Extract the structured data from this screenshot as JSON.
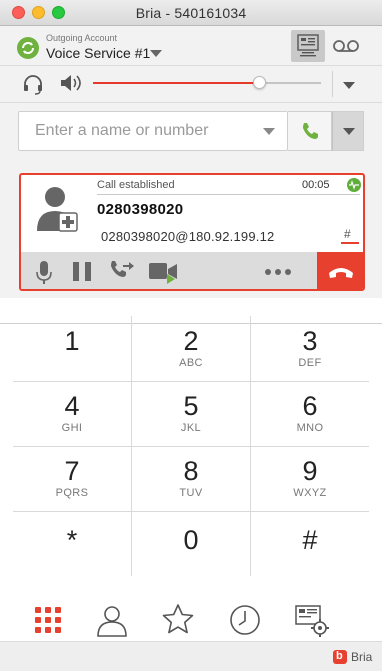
{
  "window": {
    "title": "Bria - 540161034"
  },
  "account": {
    "caption": "Outgoing Account",
    "name": "Voice Service #1"
  },
  "toolbar": {
    "icons": [
      "keypad-layout-icon",
      "voicemail-icon"
    ]
  },
  "audio": {
    "volume_percent": 73,
    "icons": [
      "headset-icon",
      "speaker-icon"
    ]
  },
  "search": {
    "placeholder": "Enter a name or number"
  },
  "call": {
    "status": "Call established",
    "timer": "00:05",
    "number": "0280398020",
    "uri": "0280398020@180.92.199.12",
    "dtmf_label": "#",
    "actions": [
      "microphone-icon",
      "pause-icon",
      "transfer-icon",
      "video-icon",
      "more-icon"
    ],
    "colors": {
      "accent": "#e8402f",
      "ok": "#5fae3b"
    }
  },
  "dialpad": {
    "keys": [
      {
        "digit": "1",
        "letters": ""
      },
      {
        "digit": "2",
        "letters": "ABC"
      },
      {
        "digit": "3",
        "letters": "DEF"
      },
      {
        "digit": "4",
        "letters": "GHI"
      },
      {
        "digit": "5",
        "letters": "JKL"
      },
      {
        "digit": "6",
        "letters": "MNO"
      },
      {
        "digit": "7",
        "letters": "PQRS"
      },
      {
        "digit": "8",
        "letters": "TUV"
      },
      {
        "digit": "9",
        "letters": "WXYZ"
      },
      {
        "digit": "*",
        "letters": ""
      },
      {
        "digit": "0",
        "letters": ""
      },
      {
        "digit": "#",
        "letters": ""
      }
    ]
  },
  "nav": {
    "items": [
      "dialpad-icon",
      "contacts-icon",
      "favorites-icon",
      "history-icon",
      "settings-icon"
    ]
  },
  "footer": {
    "brand": "Bria",
    "logo_letter": "b"
  }
}
